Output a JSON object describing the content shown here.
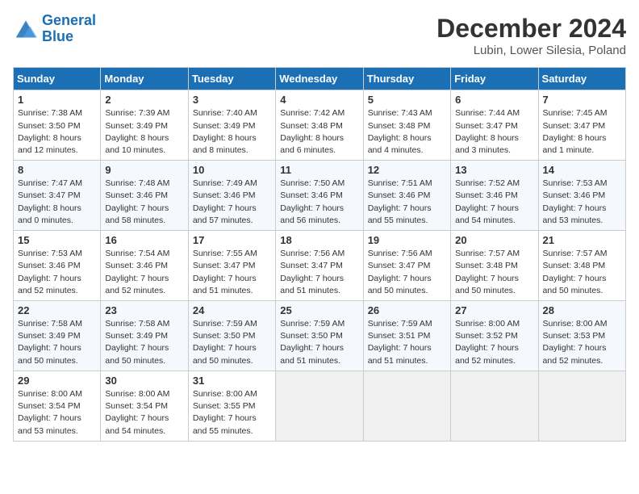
{
  "logo": {
    "line1": "General",
    "line2": "Blue"
  },
  "title": "December 2024",
  "subtitle": "Lubin, Lower Silesia, Poland",
  "weekdays": [
    "Sunday",
    "Monday",
    "Tuesday",
    "Wednesday",
    "Thursday",
    "Friday",
    "Saturday"
  ],
  "days": [
    {
      "date": 1,
      "sunrise": "7:38 AM",
      "sunset": "3:50 PM",
      "daylight": "8 hours and 12 minutes."
    },
    {
      "date": 2,
      "sunrise": "7:39 AM",
      "sunset": "3:49 PM",
      "daylight": "8 hours and 10 minutes."
    },
    {
      "date": 3,
      "sunrise": "7:40 AM",
      "sunset": "3:49 PM",
      "daylight": "8 hours and 8 minutes."
    },
    {
      "date": 4,
      "sunrise": "7:42 AM",
      "sunset": "3:48 PM",
      "daylight": "8 hours and 6 minutes."
    },
    {
      "date": 5,
      "sunrise": "7:43 AM",
      "sunset": "3:48 PM",
      "daylight": "8 hours and 4 minutes."
    },
    {
      "date": 6,
      "sunrise": "7:44 AM",
      "sunset": "3:47 PM",
      "daylight": "8 hours and 3 minutes."
    },
    {
      "date": 7,
      "sunrise": "7:45 AM",
      "sunset": "3:47 PM",
      "daylight": "8 hours and 1 minute."
    },
    {
      "date": 8,
      "sunrise": "7:47 AM",
      "sunset": "3:47 PM",
      "daylight": "8 hours and 0 minutes."
    },
    {
      "date": 9,
      "sunrise": "7:48 AM",
      "sunset": "3:46 PM",
      "daylight": "7 hours and 58 minutes."
    },
    {
      "date": 10,
      "sunrise": "7:49 AM",
      "sunset": "3:46 PM",
      "daylight": "7 hours and 57 minutes."
    },
    {
      "date": 11,
      "sunrise": "7:50 AM",
      "sunset": "3:46 PM",
      "daylight": "7 hours and 56 minutes."
    },
    {
      "date": 12,
      "sunrise": "7:51 AM",
      "sunset": "3:46 PM",
      "daylight": "7 hours and 55 minutes."
    },
    {
      "date": 13,
      "sunrise": "7:52 AM",
      "sunset": "3:46 PM",
      "daylight": "7 hours and 54 minutes."
    },
    {
      "date": 14,
      "sunrise": "7:53 AM",
      "sunset": "3:46 PM",
      "daylight": "7 hours and 53 minutes."
    },
    {
      "date": 15,
      "sunrise": "7:53 AM",
      "sunset": "3:46 PM",
      "daylight": "7 hours and 52 minutes."
    },
    {
      "date": 16,
      "sunrise": "7:54 AM",
      "sunset": "3:46 PM",
      "daylight": "7 hours and 52 minutes."
    },
    {
      "date": 17,
      "sunrise": "7:55 AM",
      "sunset": "3:47 PM",
      "daylight": "7 hours and 51 minutes."
    },
    {
      "date": 18,
      "sunrise": "7:56 AM",
      "sunset": "3:47 PM",
      "daylight": "7 hours and 51 minutes."
    },
    {
      "date": 19,
      "sunrise": "7:56 AM",
      "sunset": "3:47 PM",
      "daylight": "7 hours and 50 minutes."
    },
    {
      "date": 20,
      "sunrise": "7:57 AM",
      "sunset": "3:48 PM",
      "daylight": "7 hours and 50 minutes."
    },
    {
      "date": 21,
      "sunrise": "7:57 AM",
      "sunset": "3:48 PM",
      "daylight": "7 hours and 50 minutes."
    },
    {
      "date": 22,
      "sunrise": "7:58 AM",
      "sunset": "3:49 PM",
      "daylight": "7 hours and 50 minutes."
    },
    {
      "date": 23,
      "sunrise": "7:58 AM",
      "sunset": "3:49 PM",
      "daylight": "7 hours and 50 minutes."
    },
    {
      "date": 24,
      "sunrise": "7:59 AM",
      "sunset": "3:50 PM",
      "daylight": "7 hours and 50 minutes."
    },
    {
      "date": 25,
      "sunrise": "7:59 AM",
      "sunset": "3:50 PM",
      "daylight": "7 hours and 51 minutes."
    },
    {
      "date": 26,
      "sunrise": "7:59 AM",
      "sunset": "3:51 PM",
      "daylight": "7 hours and 51 minutes."
    },
    {
      "date": 27,
      "sunrise": "8:00 AM",
      "sunset": "3:52 PM",
      "daylight": "7 hours and 52 minutes."
    },
    {
      "date": 28,
      "sunrise": "8:00 AM",
      "sunset": "3:53 PM",
      "daylight": "7 hours and 52 minutes."
    },
    {
      "date": 29,
      "sunrise": "8:00 AM",
      "sunset": "3:54 PM",
      "daylight": "7 hours and 53 minutes."
    },
    {
      "date": 30,
      "sunrise": "8:00 AM",
      "sunset": "3:54 PM",
      "daylight": "7 hours and 54 minutes."
    },
    {
      "date": 31,
      "sunrise": "8:00 AM",
      "sunset": "3:55 PM",
      "daylight": "7 hours and 55 minutes."
    }
  ]
}
